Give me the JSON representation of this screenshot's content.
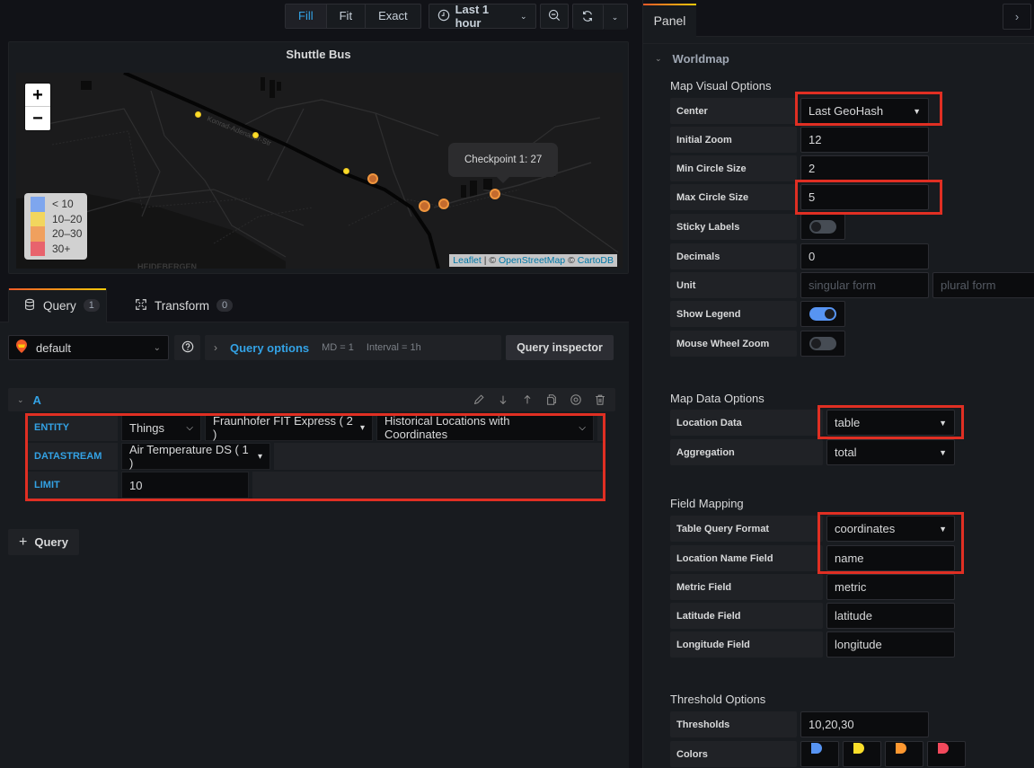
{
  "toolbar": {
    "fill": "Fill",
    "fit": "Fit",
    "exact": "Exact",
    "time_range": "Last 1 hour"
  },
  "panel": {
    "title": "Shuttle Bus",
    "tooltip": "Checkpoint 1: 27",
    "legend": [
      {
        "label": "< 10",
        "color": "#7ea6ee"
      },
      {
        "label": "10–20",
        "color": "#f2d65e"
      },
      {
        "label": "20–30",
        "color": "#f0a05e"
      },
      {
        "label": "30+",
        "color": "#e8636d"
      }
    ],
    "attribution": {
      "leaflet": "Leaflet",
      "sep": " | © ",
      "osm": "OpenStreetMap",
      "sep2": " © ",
      "carto": "CartoDB"
    },
    "zoom_in": "+",
    "zoom_out": "−",
    "street_label": "Konrad-Adenauer-Str",
    "area_label": "HEIDEBERGEN"
  },
  "query_tabs": [
    {
      "label": "Query",
      "count": "1"
    },
    {
      "label": "Transform",
      "count": "0"
    }
  ],
  "query": {
    "datasource": "default",
    "options_label": "Query options",
    "md": "MD = 1",
    "interval": "Interval = 1h",
    "inspector": "Query inspector",
    "ref_id": "A",
    "fields": {
      "entity_label": "ENTITY",
      "entity_type": "Things",
      "entity_value": "Fraunhofer FIT Express ( 2 )",
      "entity_sub": "Historical Locations with Coordinates",
      "datastream_label": "DATASTREAM",
      "datastream_value": "Air Temperature DS ( 1 )",
      "limit_label": "LIMIT",
      "limit_value": "10"
    },
    "add_query": "Query"
  },
  "options": {
    "tab": "Panel",
    "section": "Worldmap",
    "map_visual": {
      "title": "Map Visual Options",
      "center_label": "Center",
      "center": "Last GeoHash",
      "initial_zoom_label": "Initial Zoom",
      "initial_zoom": "12",
      "min_circle_label": "Min Circle Size",
      "min_circle": "2",
      "max_circle_label": "Max Circle Size",
      "max_circle": "5",
      "sticky_labels_label": "Sticky Labels",
      "sticky_labels": false,
      "decimals_label": "Decimals",
      "decimals": "0",
      "unit_label": "Unit",
      "unit_singular_placeholder": "singular form",
      "unit_plural_placeholder": "plural form",
      "show_legend_label": "Show Legend",
      "show_legend": true,
      "mouse_wheel_label": "Mouse Wheel Zoom",
      "mouse_wheel": false
    },
    "map_data": {
      "title": "Map Data Options",
      "location_data_label": "Location Data",
      "location_data": "table",
      "aggregation_label": "Aggregation",
      "aggregation": "total"
    },
    "field_mapping": {
      "title": "Field Mapping",
      "table_format_label": "Table Query Format",
      "table_format": "coordinates",
      "location_name_label": "Location Name Field",
      "location_name": "name",
      "metric_label": "Metric Field",
      "metric": "metric",
      "latitude_label": "Latitude Field",
      "latitude": "latitude",
      "longitude_label": "Longitude Field",
      "longitude": "longitude"
    },
    "threshold": {
      "title": "Threshold Options",
      "thresholds_label": "Thresholds",
      "thresholds": "10,20,30",
      "colors_label": "Colors",
      "colors": [
        "#5794f2",
        "#fade2a",
        "#ff9830",
        "#f2495c"
      ]
    }
  }
}
